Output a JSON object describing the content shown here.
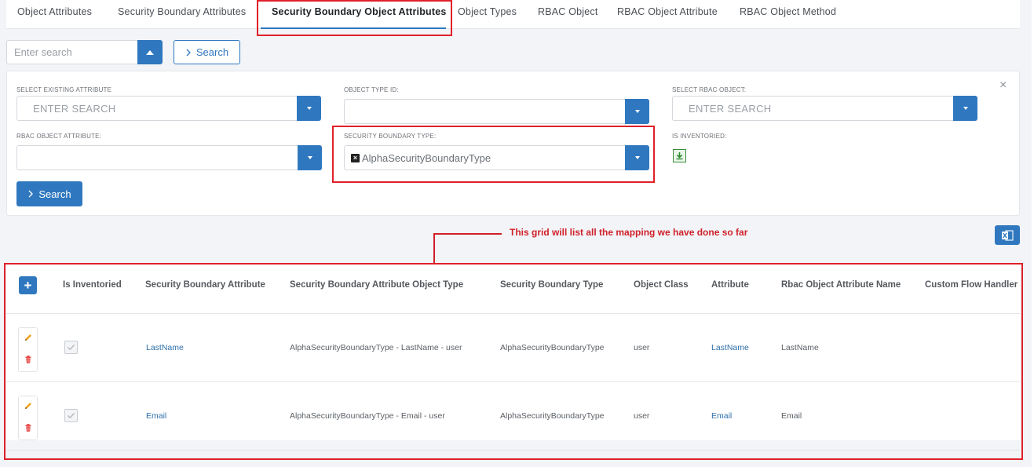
{
  "tabs": [
    {
      "label": "Object Attributes",
      "active": false
    },
    {
      "label": "Security Boundary Attributes",
      "active": false
    },
    {
      "label": "Security Boundary Object Attributes",
      "active": true
    },
    {
      "label": "Object Types",
      "active": false
    },
    {
      "label": "RBAC Object",
      "active": false
    },
    {
      "label": "RBAC Object Attribute",
      "active": false
    },
    {
      "label": "RBAC Object Method",
      "active": false
    }
  ],
  "top_search": {
    "placeholder": "Enter search",
    "button_label": "Search"
  },
  "filters": {
    "select_existing_attribute": {
      "label": "SELECT EXISTING ATTRIBUTE",
      "placeholder": "ENTER SEARCH"
    },
    "object_type_id": {
      "label": "OBJECT TYPE ID:",
      "value": ""
    },
    "select_rbac_object": {
      "label": "SELECT RBAC OBJECT:",
      "placeholder": "ENTER SEARCH"
    },
    "rbac_object_attribute": {
      "label": "RBAC OBJECT ATTRIBUTE:",
      "value": ""
    },
    "security_boundary_type": {
      "label": "SECURITY BOUNDARY TYPE:",
      "value": "AlphaSecurityBoundaryType",
      "remove_symbol": "×"
    },
    "is_inventoried": {
      "label": "IS INVENTORIED:"
    },
    "search_button_label": "Search",
    "close_symbol": "×"
  },
  "annotation": "This grid will list all the mapping we have done so far",
  "grid": {
    "add_symbol": "+",
    "columns": [
      "Is Inventoried",
      "Security Boundary Attribute",
      "Security Boundary Attribute Object Type",
      "Security Boundary Type",
      "Object Class",
      "Attribute",
      "Rbac Object Attribute Name",
      "Custom Flow Handler"
    ],
    "rows": [
      {
        "is_inventoried": true,
        "security_boundary_attribute": "LastName",
        "attribute_object_type": "AlphaSecurityBoundaryType - LastName - user",
        "security_boundary_type": "AlphaSecurityBoundaryType",
        "object_class": "user",
        "attribute": "LastName",
        "rbac_object_attribute_name": "LastName",
        "custom_flow_handler": ""
      },
      {
        "is_inventoried": true,
        "security_boundary_attribute": "Email",
        "attribute_object_type": "AlphaSecurityBoundaryType - Email - user",
        "security_boundary_type": "AlphaSecurityBoundaryType",
        "object_class": "user",
        "attribute": "Email",
        "rbac_object_attribute_name": "Email",
        "custom_flow_handler": ""
      }
    ]
  },
  "colors": {
    "primary": "#2f78bf",
    "highlight": "#e0202a",
    "annotation": "#d0202a"
  },
  "icons": {
    "top_search_toggle": "triangle-up-icon",
    "search_button": "chevron-right-icon",
    "dropdown": "caret-down-icon",
    "is_inventoried": "download-icon",
    "excel_export": "excel-icon",
    "edit": "pencil-icon",
    "delete": "trash-icon",
    "add": "plus-icon"
  }
}
